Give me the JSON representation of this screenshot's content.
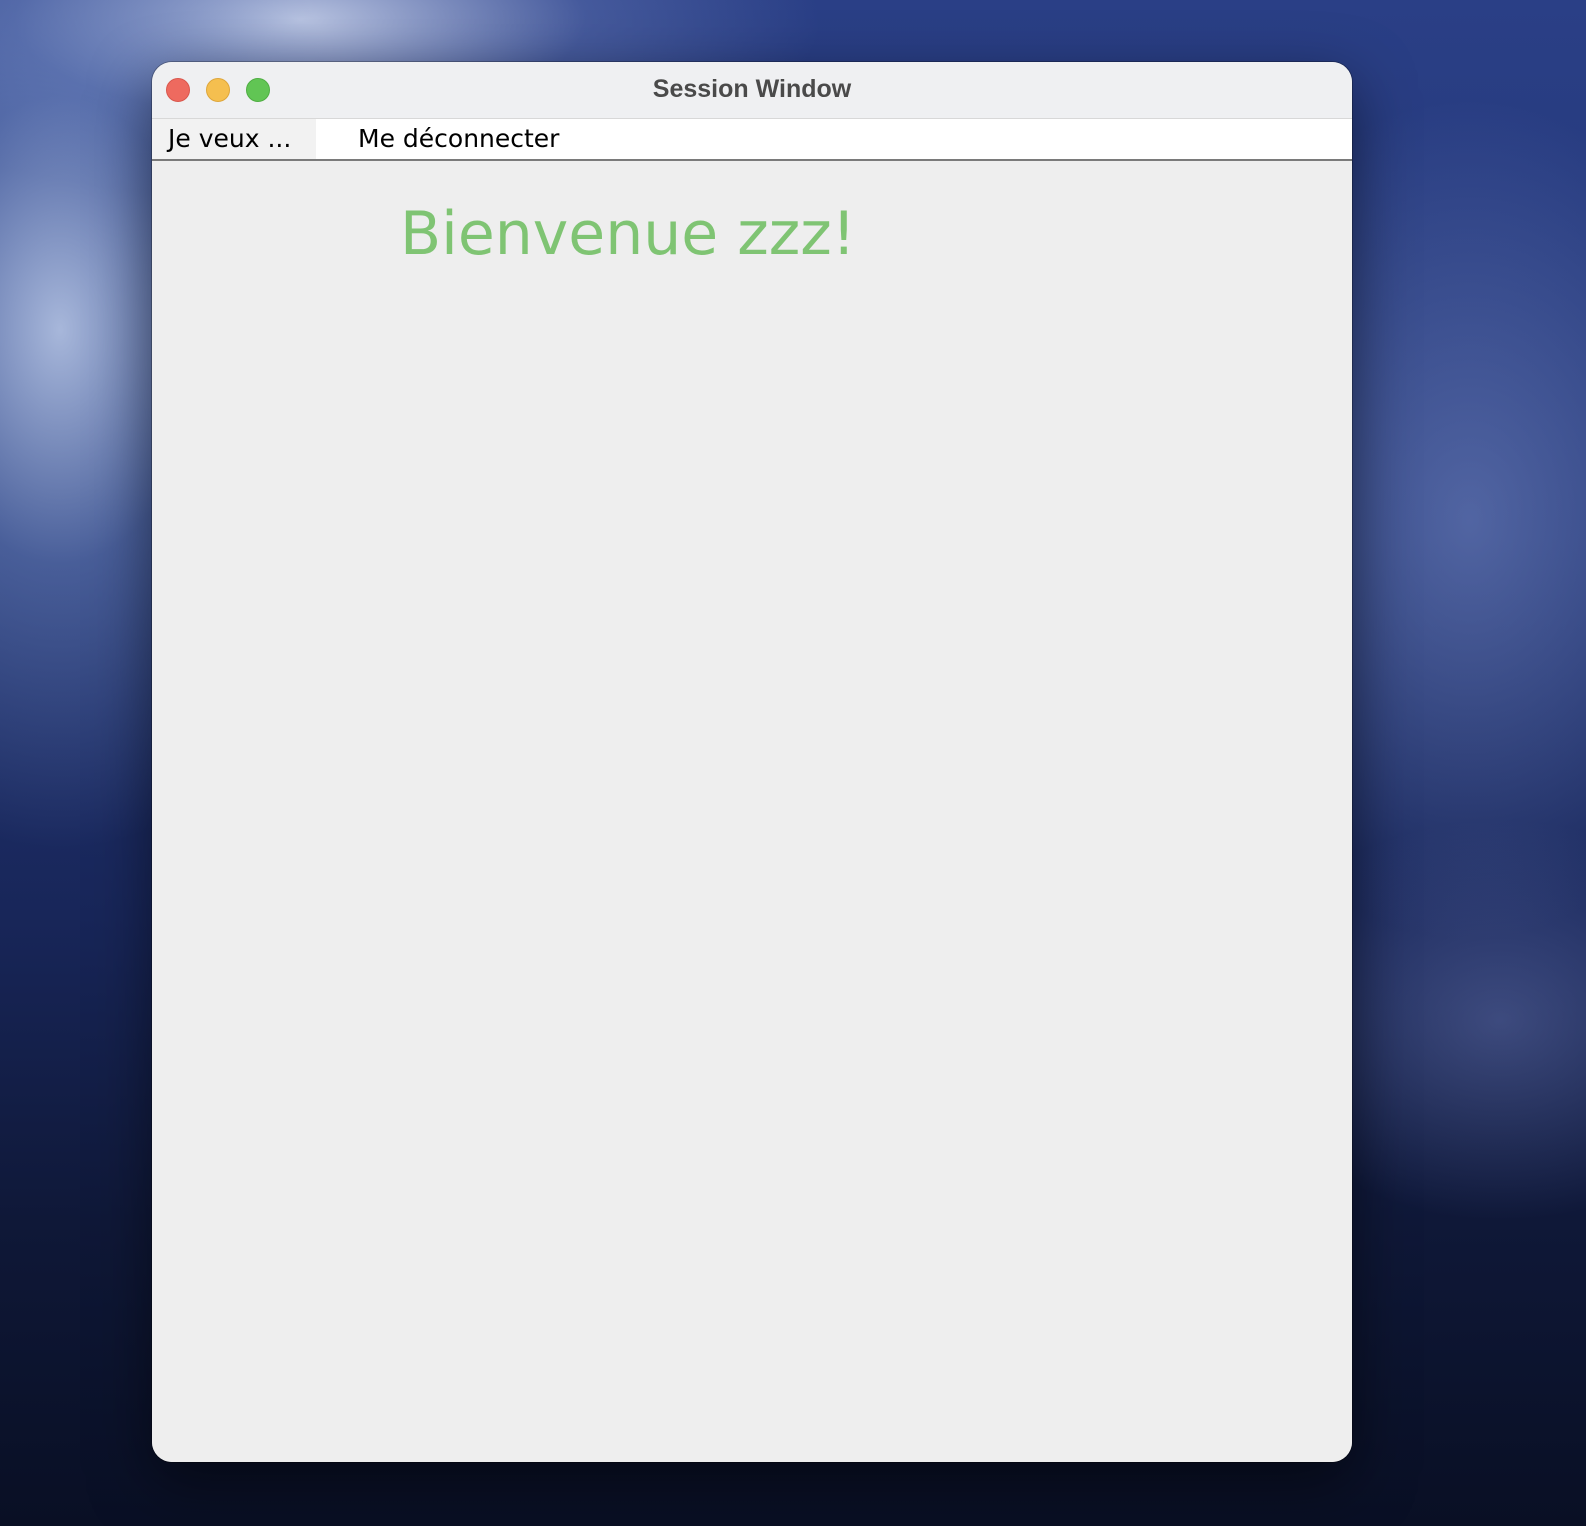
{
  "window": {
    "title": "Session Window"
  },
  "menubar": {
    "items": [
      {
        "label": "Je veux ..."
      },
      {
        "label": "Me déconnecter"
      }
    ]
  },
  "content": {
    "welcome_text": "Bienvenue zzz!",
    "welcome_color": "#7fc473"
  },
  "colors": {
    "close": "#ee6a5f",
    "minimize": "#f5bf4f",
    "maximize": "#61c554"
  }
}
